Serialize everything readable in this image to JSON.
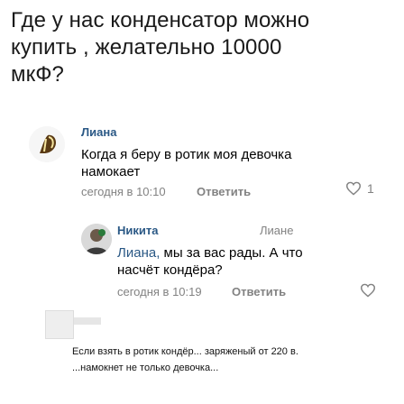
{
  "question": {
    "lines": [
      "Где у нас конденсатор можно",
      "купить , желательно 10000",
      "мкФ?"
    ]
  },
  "comment_1": {
    "author": "Лиана",
    "text_lines": [
      "Когда я беру в ротик моя девочка",
      "намокает"
    ],
    "date": "сегодня в 10:10",
    "reply_label": "Ответить",
    "likes": "1"
  },
  "comment_2": {
    "author": "Никита",
    "reply_to": "Лиане",
    "mention": "Лиана,",
    "text_line_1_rest": " мы за вас рады. А что",
    "text_line_2": "насчёт кондёра?",
    "date": "сегодня в 10:19",
    "reply_label": "Ответить"
  },
  "caption": {
    "lines": [
      "Если взять в ротик кондёр... заряженый от 220 в.",
      "...намокнет не только девочка..."
    ]
  },
  "colors": {
    "link": "#2a5885",
    "meta": "#828282"
  }
}
